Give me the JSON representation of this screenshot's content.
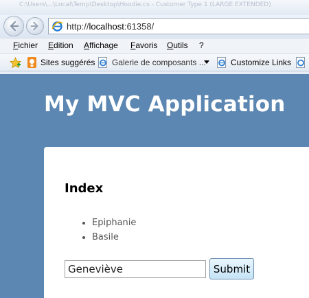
{
  "browser": {
    "window_title": "C:\\Users\\...\\Local\\Temp\\Desktop\\Hoodie.cs - Customer Type 1 (LARGE EXTENDED)",
    "address": {
      "scheme": "http://",
      "host": "localhost",
      "port_path": ":61358/"
    },
    "menu": [
      "Fichier",
      "Edition",
      "Affichage",
      "Favoris",
      "Outils",
      "?"
    ],
    "favorites": {
      "sites_label": "Sites suggérés",
      "gallery_label": "Galerie de composants ...",
      "customize_label": "Customize Links"
    }
  },
  "app": {
    "header": "My MVC Application",
    "page_title": "Index",
    "names": [
      "Epiphanie",
      "Basile"
    ],
    "input_value": "Geneviève",
    "submit_label": "Submit"
  },
  "colors": {
    "page_background": "#5c87b2",
    "panel": "#ffffff",
    "header_text": "#ffffff"
  },
  "icons": {
    "back": "back-arrow-icon",
    "forward": "forward-arrow-icon",
    "page": "ie-page-icon",
    "favorites": "favorites-star-icon",
    "suggested": "suggested-sites-icon"
  }
}
